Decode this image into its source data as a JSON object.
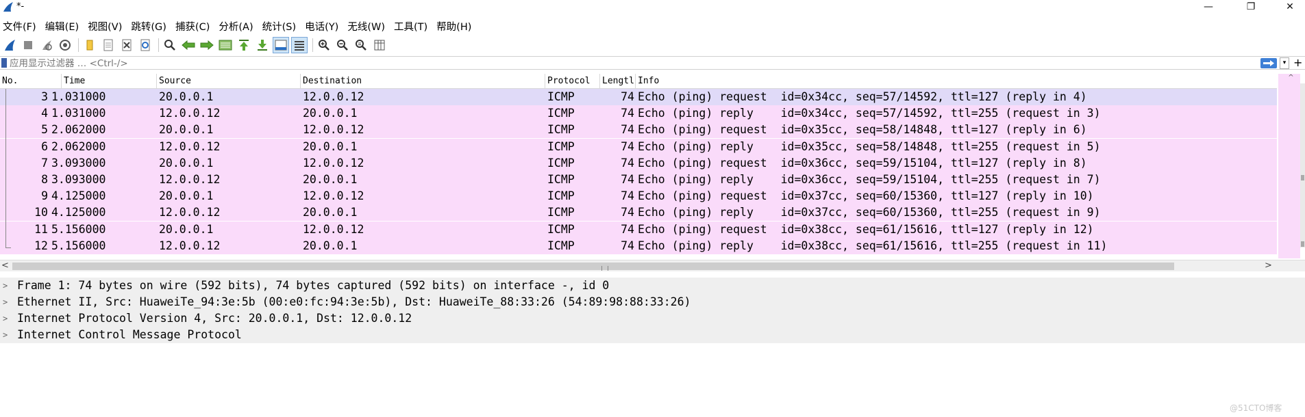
{
  "window": {
    "title": "*-",
    "minimize": "—",
    "maximize": "❐",
    "close": "✕"
  },
  "menu": [
    {
      "label": "文件(F)"
    },
    {
      "label": "编辑(E)"
    },
    {
      "label": "视图(V)"
    },
    {
      "label": "跳转(G)"
    },
    {
      "label": "捕获(C)"
    },
    {
      "label": "分析(A)"
    },
    {
      "label": "统计(S)"
    },
    {
      "label": "电话(Y)"
    },
    {
      "label": "无线(W)"
    },
    {
      "label": "工具(T)"
    },
    {
      "label": "帮助(H)"
    }
  ],
  "toolbar": {
    "icons": [
      "start-capture-icon",
      "stop-capture-icon",
      "restart-capture-icon",
      "capture-options-icon",
      "open-file-icon",
      "save-file-icon",
      "close-file-icon",
      "reload-file-icon",
      "find-packet-icon",
      "go-back-icon",
      "go-forward-icon",
      "go-to-packet-icon",
      "go-first-icon",
      "go-last-icon",
      "autoscroll-icon",
      "colorize-icon",
      "zoom-in-icon",
      "zoom-out-icon",
      "zoom-normal-icon",
      "resize-columns-icon"
    ]
  },
  "filter": {
    "placeholder": "应用显示过滤器 … <Ctrl-/>",
    "plus": "+"
  },
  "packet_list": {
    "columns": [
      "No.",
      "Time",
      "Source",
      "Destination",
      "Protocol",
      "Lengtl",
      "Info"
    ],
    "rows": [
      {
        "no": "3",
        "time": "1.031000",
        "src": "20.0.0.1",
        "dst": "12.0.0.12",
        "proto": "ICMP",
        "len": "74",
        "info": "Echo (ping) request  id=0x34cc, seq=57/14592, ttl=127 (reply in 4)"
      },
      {
        "no": "4",
        "time": "1.031000",
        "src": "12.0.0.12",
        "dst": "20.0.0.1",
        "proto": "ICMP",
        "len": "74",
        "info": "Echo (ping) reply    id=0x34cc, seq=57/14592, ttl=255 (request in 3)"
      },
      {
        "no": "5",
        "time": "2.062000",
        "src": "20.0.0.1",
        "dst": "12.0.0.12",
        "proto": "ICMP",
        "len": "74",
        "info": "Echo (ping) request  id=0x35cc, seq=58/14848, ttl=127 (reply in 6)"
      },
      {
        "no": "6",
        "time": "2.062000",
        "src": "12.0.0.12",
        "dst": "20.0.0.1",
        "proto": "ICMP",
        "len": "74",
        "info": "Echo (ping) reply    id=0x35cc, seq=58/14848, ttl=255 (request in 5)"
      },
      {
        "no": "7",
        "time": "3.093000",
        "src": "20.0.0.1",
        "dst": "12.0.0.12",
        "proto": "ICMP",
        "len": "74",
        "info": "Echo (ping) request  id=0x36cc, seq=59/15104, ttl=127 (reply in 8)"
      },
      {
        "no": "8",
        "time": "3.093000",
        "src": "12.0.0.12",
        "dst": "20.0.0.1",
        "proto": "ICMP",
        "len": "74",
        "info": "Echo (ping) reply    id=0x36cc, seq=59/15104, ttl=255 (request in 7)"
      },
      {
        "no": "9",
        "time": "4.125000",
        "src": "20.0.0.1",
        "dst": "12.0.0.12",
        "proto": "ICMP",
        "len": "74",
        "info": "Echo (ping) request  id=0x37cc, seq=60/15360, ttl=127 (reply in 10)"
      },
      {
        "no": "10",
        "time": "4.125000",
        "src": "12.0.0.12",
        "dst": "20.0.0.1",
        "proto": "ICMP",
        "len": "74",
        "info": "Echo (ping) reply    id=0x37cc, seq=60/15360, ttl=255 (request in 9)"
      },
      {
        "no": "11",
        "time": "5.156000",
        "src": "20.0.0.1",
        "dst": "12.0.0.12",
        "proto": "ICMP",
        "len": "74",
        "info": "Echo (ping) request  id=0x38cc, seq=61/15616, ttl=127 (reply in 12)"
      },
      {
        "no": "12",
        "time": "5.156000",
        "src": "12.0.0.12",
        "dst": "20.0.0.1",
        "proto": "ICMP",
        "len": "74",
        "info": "Echo (ping) reply    id=0x38cc, seq=61/15616, ttl=255 (request in 11)"
      }
    ],
    "row_color": "#fadbfa",
    "selected_color": "#e0daf8"
  },
  "scroll": {
    "left_arrow": "<",
    "right_arrow": ">",
    "up_arrow": "^"
  },
  "details": [
    {
      "arrow": ">",
      "text": "Frame 1: 74 bytes on wire (592 bits), 74 bytes captured (592 bits) on interface -, id 0"
    },
    {
      "arrow": ">",
      "text": "Ethernet II, Src: HuaweiTe_94:3e:5b (00:e0:fc:94:3e:5b), Dst: HuaweiTe_88:33:26 (54:89:98:88:33:26)"
    },
    {
      "arrow": ">",
      "text": "Internet Protocol Version 4, Src: 20.0.0.1, Dst: 12.0.0.12"
    },
    {
      "arrow": ">",
      "text": "Internet Control Message Protocol"
    }
  ],
  "watermark": "@51CTO博客"
}
